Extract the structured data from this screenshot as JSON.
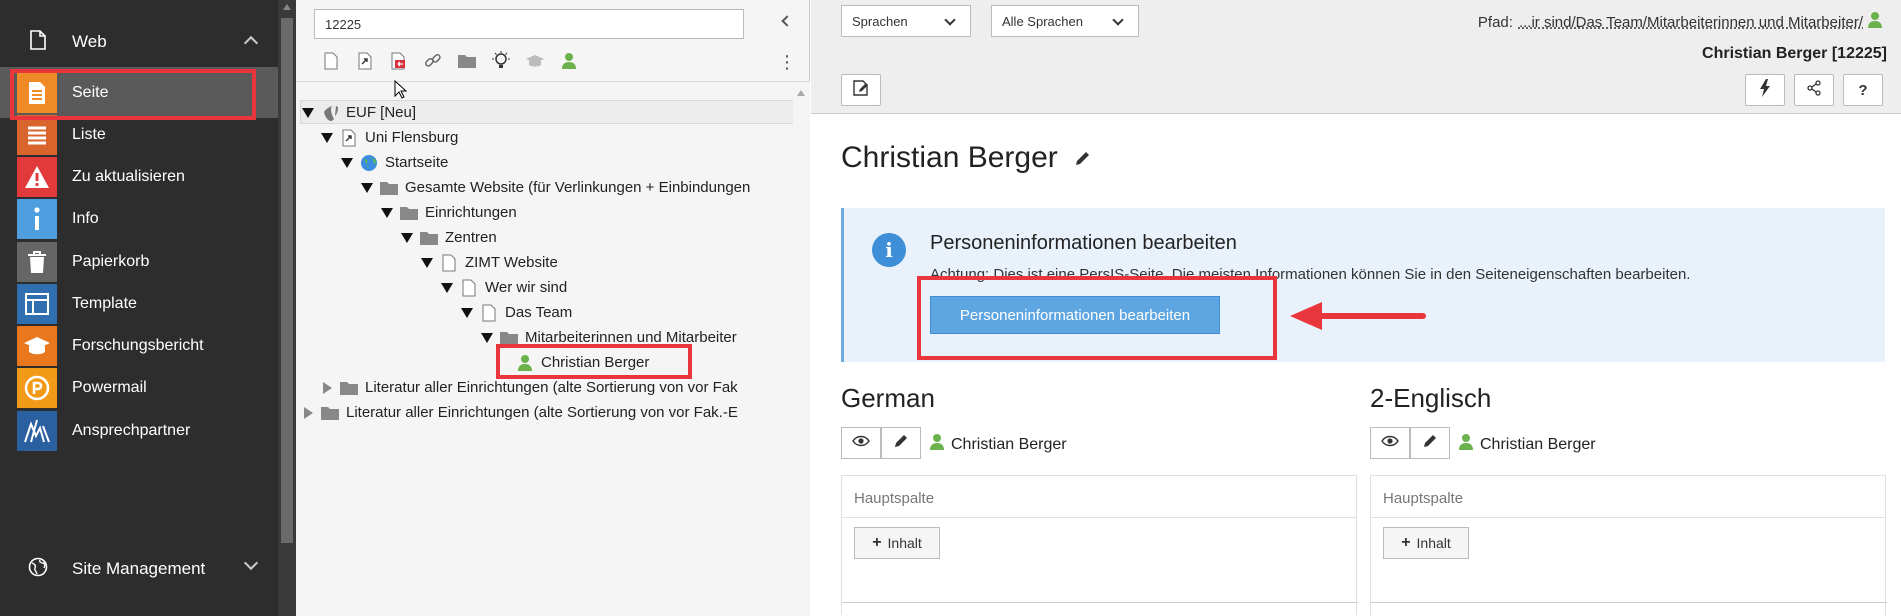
{
  "modules": {
    "web_group": {
      "label": "Web"
    },
    "items": [
      {
        "label": "Seite",
        "icon": "page-module-icon",
        "color": "#f08a26"
      },
      {
        "label": "Liste",
        "icon": "list-module-icon",
        "color": "#d9652c"
      },
      {
        "label": "Zu aktualisieren",
        "icon": "warning-module-icon",
        "color": "#e23a3a"
      },
      {
        "label": "Info",
        "icon": "info-module-icon",
        "color": "#4e9ee0"
      },
      {
        "label": "Papierkorb",
        "icon": "trash-module-icon",
        "color": "#777777"
      },
      {
        "label": "Template",
        "icon": "template-module-icon",
        "color": "#2f6fb0"
      },
      {
        "label": "Forschungsbericht",
        "icon": "graduation-module-icon",
        "color": "#e9771e"
      },
      {
        "label": "Powermail",
        "icon": "powermail-module-icon",
        "color": "#f09a18"
      },
      {
        "label": "Ansprechpartner",
        "icon": "contact-module-icon",
        "color": "#2a5fa0"
      }
    ],
    "site_group": {
      "label": "Site Management"
    }
  },
  "tree": {
    "search_value": "12225",
    "root": "EUF [Neu]",
    "nodes": [
      {
        "label": "Uni Flensburg"
      },
      {
        "label": "Startseite"
      },
      {
        "label": "Gesamte Website (für Verlinkungen + Einbindungen"
      },
      {
        "label": "Einrichtungen"
      },
      {
        "label": "Zentren"
      },
      {
        "label": "ZIMT Website"
      },
      {
        "label": "Wer wir sind"
      },
      {
        "label": "Das Team"
      },
      {
        "label": "Mitarbeiterinnen und Mitarbeiter"
      },
      {
        "label": "Christian Berger"
      },
      {
        "label": "Literatur aller Einrichtungen (alte Sortierung von vor Fak"
      },
      {
        "label": "Literatur aller Einrichtungen (alte Sortierung von vor Fak.-E"
      }
    ]
  },
  "header": {
    "language_select": "Sprachen",
    "language_filter": "Alle Sprachen",
    "path_label": "Pfad:",
    "path_value": "...ir sind/Das Team/Mitarbeiterinnen und Mitarbeiter/",
    "page_title": "Christian Berger [12225]"
  },
  "main": {
    "title": "Christian Berger",
    "info": {
      "title": "Personeninformationen bearbeiten",
      "text": "Achtung: Dies ist eine PersIS-Seite. Die meisten Informationen können Sie in den Seiteneigenschaften bearbeiten.",
      "button": "Personeninformationen bearbeiten"
    },
    "languages": [
      {
        "title": "German",
        "user": "Christian Berger",
        "column": "Hauptspalte",
        "add": "Inhalt"
      },
      {
        "title": "2-Englisch",
        "user": "Christian Berger",
        "column": "Hauptspalte",
        "add": "Inhalt"
      }
    ]
  },
  "colors": {
    "highlight": "#e8363c",
    "info_bg": "#e9f2fb",
    "primary": "#5ea6e2"
  }
}
